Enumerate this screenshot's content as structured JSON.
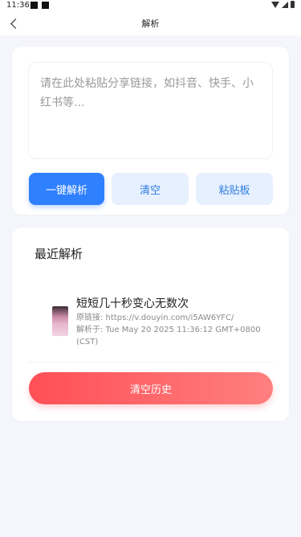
{
  "status_bar": {
    "time": "11:36"
  },
  "navbar": {
    "title": "解析"
  },
  "parse_card": {
    "input_placeholder": "请在此处粘贴分享链接，如抖音、快手、小红书等...",
    "parse_button": "一键解析",
    "clear_button": "清空",
    "paste_button": "粘贴板"
  },
  "recent": {
    "title": "最近解析",
    "items": [
      {
        "title": "短短几十秒变心无数次",
        "source": "原链接: https://v.douyin.com/i5AW6YFC/",
        "parsed_at": "解析于: Tue May 20 2025 11:36:12 GMT+0800 (CST)"
      }
    ],
    "clear_history_button": "清空历史"
  },
  "colors": {
    "primary": "#2f80ff",
    "secondary_bg": "#e7f0ff",
    "danger_gradient_start": "#ff4f56",
    "danger_gradient_end": "#ff7f7f"
  }
}
